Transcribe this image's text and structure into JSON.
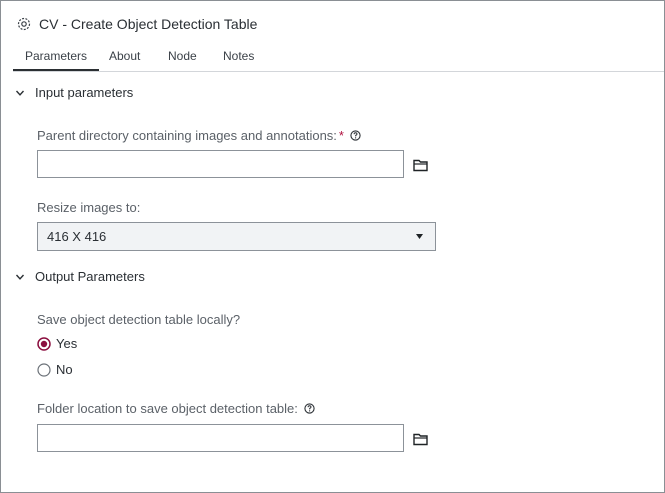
{
  "window": {
    "title": "CV - Create Object Detection Table",
    "title_icon": "eye-settings-icon"
  },
  "tabs": [
    {
      "label": "Parameters",
      "active": true
    },
    {
      "label": "About",
      "active": false
    },
    {
      "label": "Node",
      "active": false
    },
    {
      "label": "Notes",
      "active": false
    }
  ],
  "sections": {
    "input": {
      "label": "Input parameters",
      "expanded": true
    },
    "output": {
      "label": "Output Parameters",
      "expanded": true
    }
  },
  "fields": {
    "parent_dir": {
      "label": "Parent directory containing images and annotations:",
      "required_mark": "*",
      "value": "",
      "placeholder": ""
    },
    "resize": {
      "label": "Resize images to:",
      "selected": "416 X 416"
    },
    "save_locally": {
      "label": "Save object detection table locally?",
      "options": [
        {
          "label": "Yes",
          "checked": true
        },
        {
          "label": "No",
          "checked": false
        }
      ]
    },
    "folder_location": {
      "label": "Folder location to save object detection table:",
      "value": "",
      "placeholder": ""
    }
  },
  "colors": {
    "accent": "#8b0f3f",
    "border": "#8c9299",
    "select_bg": "#f1f3f5"
  }
}
